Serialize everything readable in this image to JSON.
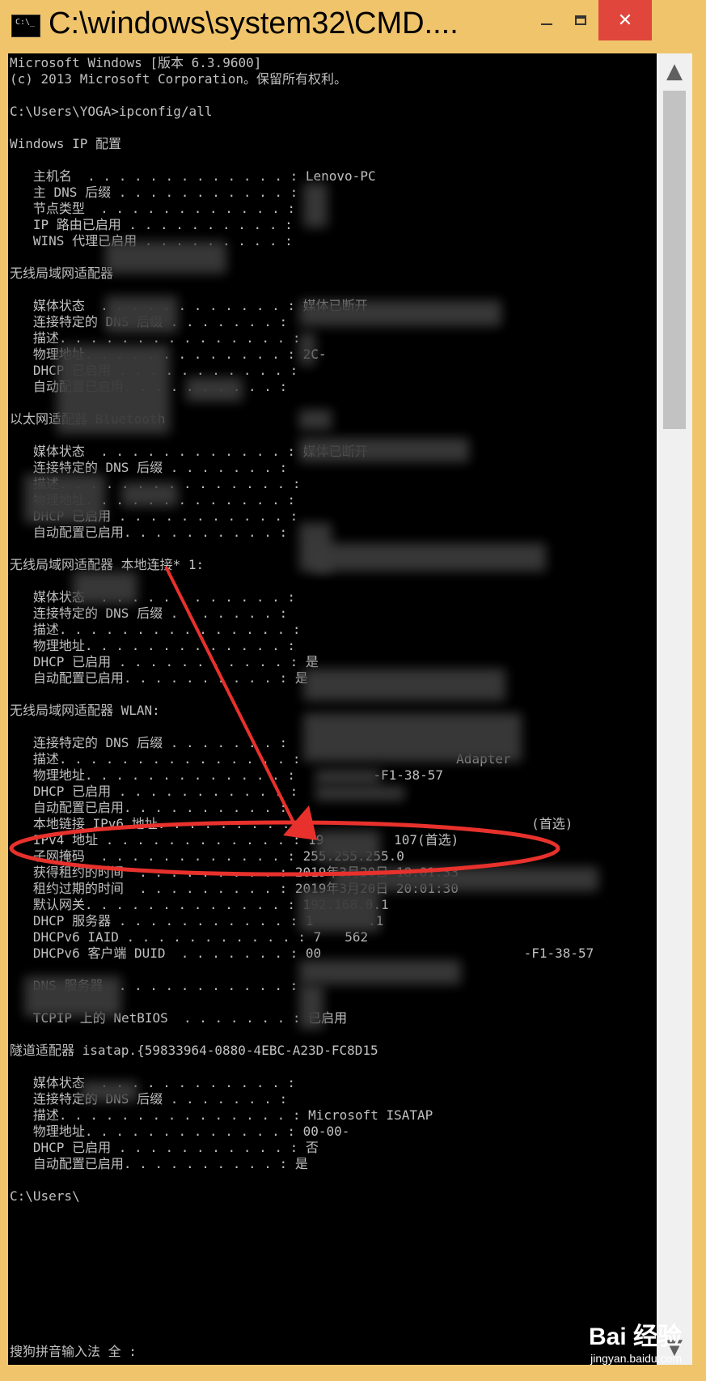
{
  "window": {
    "title": "C:\\windows\\system32\\CMD....",
    "close_glyph": "✕",
    "icon_glyph": "C:\\_"
  },
  "console": {
    "lines": [
      "Microsoft Windows [版本 6.3.9600]",
      "(c) 2013 Microsoft Corporation。保留所有权利。",
      "",
      "C:\\Users\\YOGA>ipconfig/all",
      "",
      "Windows IP 配置",
      "",
      "   主机名  . . . . . . . . . . . . . : Lenovo-PC",
      "   主 DNS 后缀 . . . . . . . . . . . :",
      "   节点类型  . . . . . . . . . . . . :",
      "   IP 路由已启用 . . . . . . . . . . :",
      "   WINS 代理已启用 . . . . . . . . . :",
      "",
      "无线局域网适配器",
      "",
      "   媒体状态  . . . . . . . . . . . . : 媒体已断开",
      "   连接特定的 DNS 后缀 . . . . . . . :",
      "   描述. . . . . . . . . . . . . . . :",
      "   物理地址. . . . . . . . . . . . . : 2C-",
      "   DHCP 已启用 . . . . . . . . . . . :",
      "   自动配置已启用. . . . . . . . . . :",
      "",
      "以太网适配器 Bluetooth",
      "",
      "   媒体状态  . . . . . . . . . . . . : 媒体已断开",
      "   连接特定的 DNS 后缀 . . . . . . . :",
      "   描述. . . . . . . . . . . . . . . :",
      "   物理地址. . . . . . . . . . . . . :",
      "   DHCP 已启用 . . . . . . . . . . . :",
      "   自动配置已启用. . . . . . . . . . :",
      "",
      "无线局域网适配器 本地连接* 1:",
      "",
      "   媒体状态  . . . . . . . . . . . . :",
      "   连接特定的 DNS 后缀 . . . . . . . :",
      "   描述. . . . . . . . . . . . . . . :",
      "   物理地址. . . . . . . . . . . . . :",
      "   DHCP 已启用 . . . . . . . . . . . : 是",
      "   自动配置已启用. . . . . . . . . . : 是",
      "",
      "无线局域网适配器 WLAN:",
      "",
      "   连接特定的 DNS 后缀 . . . . . . . :",
      "   描述. . . . . . . . . . . . . . . :                    Adapter",
      "   物理地址. . . . . . . . . . . . . :          -F1-38-57",
      "   DHCP 已启用 . . . . . . . . . . . :",
      "   自动配置已启用. . . . . . . . . . :",
      "   本地链接 IPv6 地址. . . . . . . . :                               (首选)",
      "   IPv4 地址 . . . . . . . . . . . . : 19         107(首选)",
      "   子网掩码  . . . . . . . . . . . . : 255.255.255.0",
      "   获得租约的时间  . . . . . . . . . : 2019年3月20日 18:01:33",
      "   租约过期的时间  . . . . . . . . . : 2019年3月20日 20:01:30",
      "   默认网关. . . . . . . . . . . . . : 192.168.0.1",
      "   DHCP 服务器 . . . . . . . . . . . : 1       .1",
      "   DHCPv6 IAID . . . . . . . . . . . : 7   562",
      "   DHCPv6 客户端 DUID  . . . . . . . : 00                          -F1-38-57",
      "",
      "   DNS 服务器  . . . . . . . . . . . :",
      "",
      "   TCPIP 上的 NetBIOS  . . . . . . . : 已启用",
      "",
      "隧道适配器 isatap.{59833964-0880-4EBC-A23D-FC8D15",
      "",
      "   媒体状态  . . . . . . . . . . . . :",
      "   连接特定的 DNS 后缀 . . . . . . . :",
      "   描述. . . . . . . . . . . . . . . : Microsoft ISATAP",
      "   物理地址. . . . . . . . . . . . . : 00-00-",
      "   DHCP 已启用 . . . . . . . . . . . : 否",
      "   自动配置已启用. . . . . . . . . . : 是",
      "",
      "C:\\Users\\"
    ],
    "ime_status": "搜狗拼音输入法 全 :"
  },
  "scrollbar": {
    "up_glyph": "▲",
    "down_glyph": "▼"
  },
  "watermark": {
    "logo": "Bai  经验",
    "site": "jingyan.baidu.com"
  },
  "colors": {
    "frame": "#f0c46a",
    "close": "#e0463c",
    "console_bg": "#000000",
    "console_text": "#c0c0c0",
    "annotation": "#e8312c"
  }
}
